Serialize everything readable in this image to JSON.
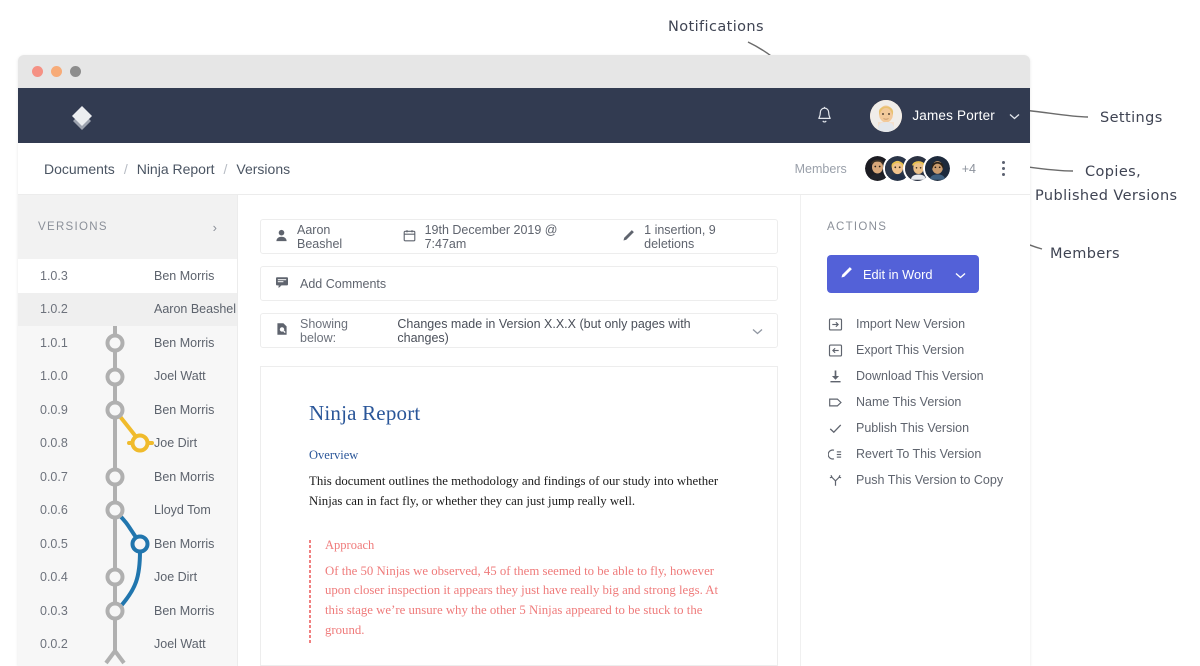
{
  "window": {
    "traffic_lights": [
      "close",
      "minimize",
      "zoom"
    ]
  },
  "navbar": {
    "logo_name": "diamond-logo",
    "bell_icon": "bell-icon",
    "user_name": "James Porter",
    "user_caret": "⌄"
  },
  "breadcrumb": {
    "items": [
      "Documents",
      "Ninja Report",
      "Versions"
    ],
    "separator": "/",
    "members_label": "Members",
    "overflow_count": "+4"
  },
  "sidebar": {
    "title": "VERSIONS",
    "chevron": "›",
    "versions": [
      {
        "number": "1.0.3",
        "author": "Ben Morris",
        "state": "current",
        "node": "filled-dark"
      },
      {
        "number": "1.0.2",
        "author": "Aaron Beashel",
        "state": "selected",
        "node": "ring-maroon"
      },
      {
        "number": "1.0.1",
        "author": "Ben Morris",
        "state": "normal",
        "node": "ring-grey"
      },
      {
        "number": "1.0.0",
        "author": "Joel Watt",
        "state": "normal",
        "node": "ring-grey"
      },
      {
        "number": "0.0.9",
        "author": "Ben Morris",
        "state": "normal",
        "node": "ring-grey"
      },
      {
        "number": "0.0.8",
        "author": "Joe Dirt",
        "state": "normal",
        "node": "ring-yellow-branch"
      },
      {
        "number": "0.0.7",
        "author": "Ben Morris",
        "state": "normal",
        "node": "ring-grey"
      },
      {
        "number": "0.0.6",
        "author": "Lloyd Tom",
        "state": "normal",
        "node": "ring-grey"
      },
      {
        "number": "0.0.5",
        "author": "Ben Morris",
        "state": "normal",
        "node": "ring-blue-branch"
      },
      {
        "number": "0.0.4",
        "author": "Joe Dirt",
        "state": "normal",
        "node": "ring-grey"
      },
      {
        "number": "0.0.3",
        "author": "Ben Morris",
        "state": "normal",
        "node": "ring-grey"
      },
      {
        "number": "0.0.2",
        "author": "Joel Watt",
        "state": "normal",
        "node": "ring-grey"
      }
    ]
  },
  "main": {
    "info": {
      "author_icon": "person-icon",
      "author": "Aaron Beashel",
      "date_icon": "calendar-icon",
      "date": "19th December 2019 @ 7:47am",
      "edits_icon": "pencil-icon",
      "edits": "1 insertion, 9 deletions"
    },
    "comments": {
      "icon": "comment-icon",
      "label": "Add Comments"
    },
    "showing": {
      "icon": "document-search-icon",
      "label": "Showing below:",
      "value": "Changes made in Version X.X.X (but only pages with changes)",
      "caret": "⌄"
    },
    "document": {
      "title": "Ninja Report",
      "overview_heading": "Overview",
      "overview_body": "This document outlines the methodology and findings of our study into whether Ninjas can in fact fly, or whether they can just jump really well.",
      "approach_heading": "Approach",
      "approach_body": "Of the 50 Ninjas we observed, 45 of them seemed to be able to fly, however upon closer inspection it appears they just have really big and strong legs. At this stage we’re unsure why the other 5 Ninjas appeared to be stuck to the ground."
    }
  },
  "actions": {
    "title": "ACTIONS",
    "primary": {
      "icon": "pencil-icon",
      "label": "Edit in Word",
      "caret": "⌄",
      "color": "#5361d8"
    },
    "items": [
      {
        "icon": "import-icon",
        "label": "Import New Version"
      },
      {
        "icon": "export-icon",
        "label": "Export This Version"
      },
      {
        "icon": "download-icon",
        "label": "Download This Version"
      },
      {
        "icon": "tag-icon",
        "label": "Name This Version"
      },
      {
        "icon": "check-icon",
        "label": "Publish This Version"
      },
      {
        "icon": "revert-icon",
        "label": "Revert To This Version"
      },
      {
        "icon": "branch-icon",
        "label": "Push This Version to Copy"
      }
    ]
  },
  "annotations": [
    {
      "id": "notifications",
      "text": "Notifications"
    },
    {
      "id": "settings",
      "text": "Settings"
    },
    {
      "id": "copies-line1",
      "text": "Copies,"
    },
    {
      "id": "copies-line2",
      "text": "Published Versions"
    },
    {
      "id": "members",
      "text": "Members"
    }
  ],
  "colors": {
    "navbar": "#323b51",
    "accent": "#5361d8",
    "branch_yellow": "#f0bb2c",
    "branch_blue": "#2176ae",
    "doc_blue": "#2a5699",
    "changed_red": "#ef7b7b"
  }
}
